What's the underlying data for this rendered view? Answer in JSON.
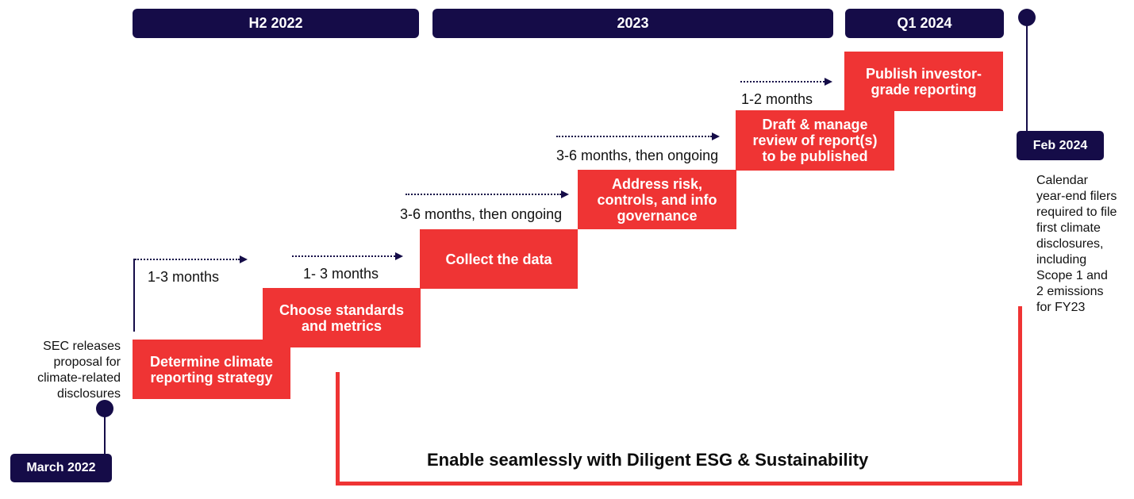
{
  "periods": [
    {
      "label": "H2 2022"
    },
    {
      "label": "2023"
    },
    {
      "label": "Q1 2024"
    }
  ],
  "steps": [
    {
      "label": "Determine climate\nreporting strategy",
      "duration": "1-3 months"
    },
    {
      "label": "Choose standards\nand metrics",
      "duration": "1- 3 months"
    },
    {
      "label": "Collect the data",
      "duration": "3-6 months, then ongoing"
    },
    {
      "label": "Address risk,\ncontrols, and info\ngovernance",
      "duration": "3-6 months, then ongoing"
    },
    {
      "label": "Draft & manage\nreview of report(s)\nto be published",
      "duration": "1-2 months"
    },
    {
      "label": "Publish investor-\ngrade reporting"
    }
  ],
  "milestones": {
    "start": {
      "date": "March 2022",
      "note": "SEC releases\nproposal for\nclimate-related\ndisclosures"
    },
    "end": {
      "date": "Feb 2024",
      "note": "Calendar\nyear-end filers\nrequired to file\nfirst climate\ndisclosures,\nincluding\nScope 1 and\n2 emissions\nfor FY23"
    }
  },
  "banner": {
    "text": "Enable seamlessly with Diligent ESG & Sustainability"
  },
  "colors": {
    "navy": "#150c48",
    "red": "#ef3434"
  }
}
